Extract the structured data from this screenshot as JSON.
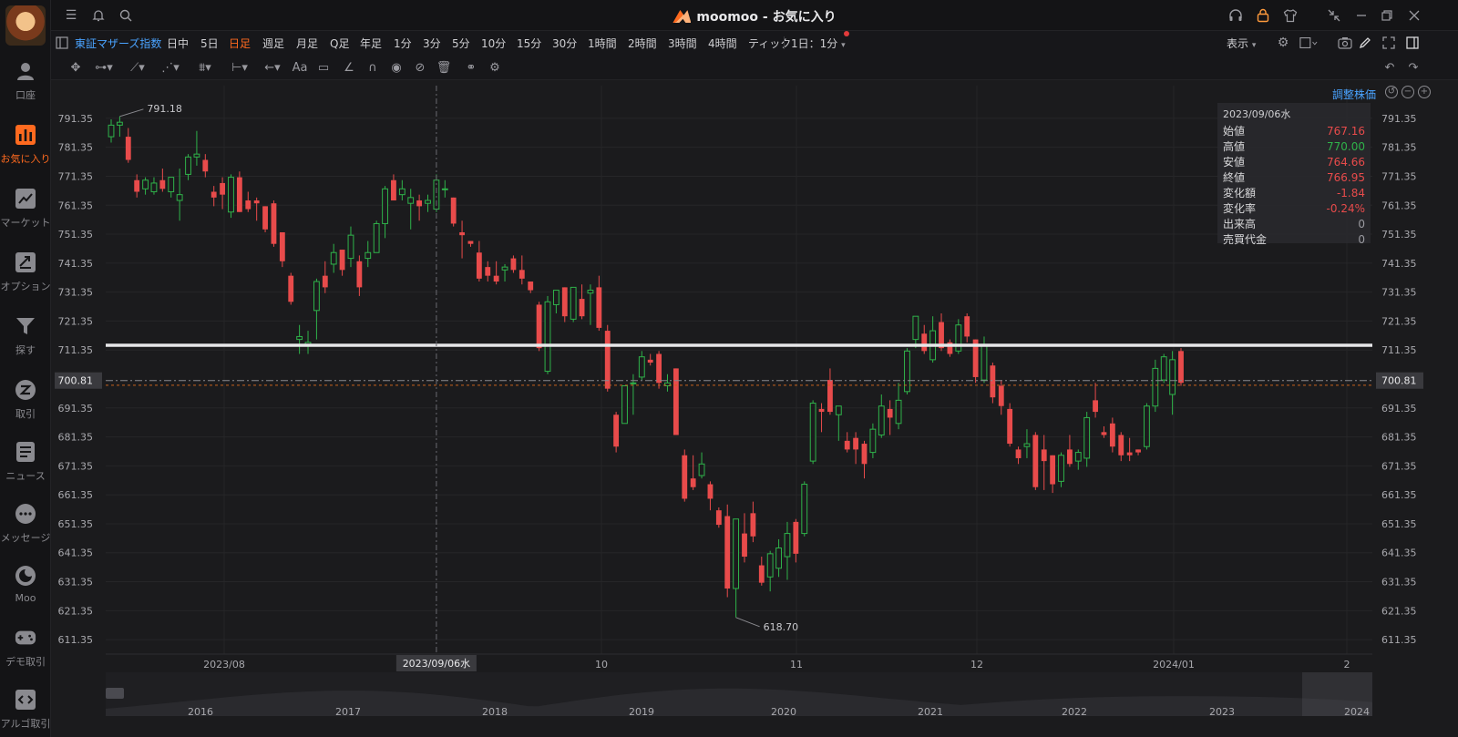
{
  "window": {
    "title": "moomoo - お気に入り"
  },
  "sidebar": {
    "items": [
      {
        "label": "口座",
        "icon": "person-icon"
      },
      {
        "label": "お気に入り",
        "icon": "bar-chart-icon"
      },
      {
        "label": "マーケット",
        "icon": "trend-icon"
      },
      {
        "label": "オプション",
        "icon": "option-icon"
      },
      {
        "label": "探す",
        "icon": "filter-icon"
      },
      {
        "label": "取引",
        "icon": "trade-icon"
      },
      {
        "label": "ニュース",
        "icon": "news-icon"
      },
      {
        "label": "メッセージ",
        "icon": "message-icon"
      },
      {
        "label": "Moo",
        "icon": "moo-icon"
      },
      {
        "label": "デモ取引",
        "icon": "gamepad-icon"
      },
      {
        "label": "アルゴ取引",
        "icon": "code-icon"
      }
    ],
    "active_index": 1
  },
  "toolbar": {
    "symbol": "東証マザーズ指数",
    "timeframes": [
      "日中",
      "5日",
      "日足",
      "週足",
      "月足",
      "Q足",
      "年足",
      "1分",
      "3分",
      "5分",
      "10分",
      "15分",
      "30分",
      "1時間",
      "2時間",
      "3時間",
      "4時間",
      "ティック"
    ],
    "active_timeframe": "日足",
    "interval_select": "1日：1分",
    "display_label": "表示"
  },
  "chart": {
    "adjust_label": "調整株価",
    "cursor_date_label": "2023/09/06水",
    "current_price_label": "700.81",
    "max_label": "791.18",
    "min_label": "618.70",
    "y_ticks": [
      "791.35",
      "781.35",
      "771.35",
      "761.35",
      "751.35",
      "741.35",
      "731.35",
      "721.35",
      "711.35",
      "700.81",
      "691.35",
      "681.35",
      "671.35",
      "661.35",
      "651.35",
      "641.35",
      "631.35",
      "621.35",
      "611.35"
    ],
    "x_ticks": [
      "2023/08",
      "10",
      "11",
      "12",
      "2024/01",
      "2"
    ],
    "navigator_years": [
      "2016",
      "2017",
      "2018",
      "2019",
      "2020",
      "2021",
      "2022",
      "2023",
      "2024"
    ]
  },
  "ohlc": {
    "date": "2023/09/06水",
    "rows": [
      {
        "label": "始値",
        "value": "767.16",
        "tone": "red"
      },
      {
        "label": "高値",
        "value": "770.00",
        "tone": "green"
      },
      {
        "label": "安値",
        "value": "764.66",
        "tone": "red"
      },
      {
        "label": "終値",
        "value": "766.95",
        "tone": "red"
      },
      {
        "label": "変化額",
        "value": "-1.84",
        "tone": "red"
      },
      {
        "label": "変化率",
        "value": "-0.24%",
        "tone": "red"
      },
      {
        "label": "出来高",
        "value": "0",
        "tone": "grey"
      },
      {
        "label": "売買代金",
        "value": "0",
        "tone": "grey"
      }
    ]
  },
  "colors": {
    "up": "#2fb34a",
    "down": "#e84b4b",
    "accent": "#ff6a1f",
    "link": "#4aa3ff"
  },
  "chart_data": {
    "type": "candlestick",
    "ylim": [
      606.35,
      796.35
    ],
    "candles": [
      {
        "o": 785,
        "h": 791,
        "l": 783,
        "c": 789
      },
      {
        "o": 789,
        "h": 792,
        "l": 785,
        "c": 790
      },
      {
        "o": 785,
        "h": 788,
        "l": 776,
        "c": 777
      },
      {
        "o": 770,
        "h": 772,
        "l": 764,
        "c": 766
      },
      {
        "o": 767,
        "h": 771,
        "l": 765,
        "c": 770
      },
      {
        "o": 766,
        "h": 771,
        "l": 765,
        "c": 769
      },
      {
        "o": 770,
        "h": 774,
        "l": 766,
        "c": 767
      },
      {
        "o": 766,
        "h": 771,
        "l": 764,
        "c": 771
      },
      {
        "o": 763,
        "h": 774,
        "l": 756,
        "c": 765
      },
      {
        "o": 772,
        "h": 779,
        "l": 770,
        "c": 778
      },
      {
        "o": 778,
        "h": 787,
        "l": 775,
        "c": 779
      },
      {
        "o": 777,
        "h": 779,
        "l": 771,
        "c": 773
      },
      {
        "o": 766,
        "h": 768,
        "l": 761,
        "c": 764
      },
      {
        "o": 769,
        "h": 771,
        "l": 760,
        "c": 765
      },
      {
        "o": 759,
        "h": 772,
        "l": 757,
        "c": 771
      },
      {
        "o": 771,
        "h": 773,
        "l": 759,
        "c": 759
      },
      {
        "o": 763,
        "h": 766,
        "l": 759,
        "c": 760
      },
      {
        "o": 763,
        "h": 764,
        "l": 756,
        "c": 762
      },
      {
        "o": 761,
        "h": 761,
        "l": 752,
        "c": 753
      },
      {
        "o": 762,
        "h": 763,
        "l": 747,
        "c": 748
      },
      {
        "o": 752,
        "h": 752,
        "l": 740,
        "c": 742
      },
      {
        "o": 737,
        "h": 738,
        "l": 727,
        "c": 728
      },
      {
        "o": 715,
        "h": 720,
        "l": 710,
        "c": 716
      },
      {
        "o": 713,
        "h": 718,
        "l": 710,
        "c": 714
      },
      {
        "o": 725,
        "h": 736,
        "l": 715,
        "c": 735
      },
      {
        "o": 737,
        "h": 742,
        "l": 731,
        "c": 733
      },
      {
        "o": 741,
        "h": 748,
        "l": 738,
        "c": 745
      },
      {
        "o": 746,
        "h": 746,
        "l": 737,
        "c": 739
      },
      {
        "o": 743,
        "h": 754,
        "l": 740,
        "c": 751
      },
      {
        "o": 742,
        "h": 744,
        "l": 730,
        "c": 733
      },
      {
        "o": 743,
        "h": 749,
        "l": 740,
        "c": 745
      },
      {
        "o": 745,
        "h": 756,
        "l": 745,
        "c": 755
      },
      {
        "o": 755,
        "h": 768,
        "l": 750,
        "c": 767
      },
      {
        "o": 770,
        "h": 772,
        "l": 763,
        "c": 763
      },
      {
        "o": 765,
        "h": 770,
        "l": 763,
        "c": 767
      },
      {
        "o": 762,
        "h": 767,
        "l": 753,
        "c": 764
      },
      {
        "o": 763,
        "h": 765,
        "l": 756,
        "c": 761
      },
      {
        "o": 762,
        "h": 765,
        "l": 759,
        "c": 763
      },
      {
        "o": 760,
        "h": 772,
        "l": 759,
        "c": 770
      },
      {
        "o": 767,
        "h": 770,
        "l": 764,
        "c": 767
      },
      {
        "o": 764,
        "h": 764,
        "l": 754,
        "c": 755
      },
      {
        "o": 752,
        "h": 756,
        "l": 743,
        "c": 751
      },
      {
        "o": 749,
        "h": 749,
        "l": 747,
        "c": 748
      },
      {
        "o": 745,
        "h": 749,
        "l": 735,
        "c": 736
      },
      {
        "o": 740,
        "h": 742,
        "l": 735,
        "c": 737
      },
      {
        "o": 737,
        "h": 742,
        "l": 734,
        "c": 735
      },
      {
        "o": 739,
        "h": 741,
        "l": 735,
        "c": 740
      },
      {
        "o": 743,
        "h": 744,
        "l": 738,
        "c": 739
      },
      {
        "o": 739,
        "h": 744,
        "l": 734,
        "c": 736
      },
      {
        "o": 735,
        "h": 735,
        "l": 731,
        "c": 732
      },
      {
        "o": 727,
        "h": 728,
        "l": 711,
        "c": 712
      },
      {
        "o": 704,
        "h": 730,
        "l": 703,
        "c": 728
      },
      {
        "o": 727,
        "h": 732,
        "l": 724,
        "c": 732
      },
      {
        "o": 733,
        "h": 733,
        "l": 721,
        "c": 723
      },
      {
        "o": 722,
        "h": 733,
        "l": 721,
        "c": 733
      },
      {
        "o": 729,
        "h": 734,
        "l": 722,
        "c": 723
      },
      {
        "o": 731,
        "h": 734,
        "l": 720,
        "c": 732
      },
      {
        "o": 733,
        "h": 737,
        "l": 718,
        "c": 719
      },
      {
        "o": 718,
        "h": 720,
        "l": 697,
        "c": 698
      },
      {
        "o": 689,
        "h": 690,
        "l": 676,
        "c": 678
      },
      {
        "o": 686,
        "h": 699,
        "l": 686,
        "c": 699
      },
      {
        "o": 700,
        "h": 703,
        "l": 689,
        "c": 700
      },
      {
        "o": 702,
        "h": 711,
        "l": 701,
        "c": 709
      },
      {
        "o": 708,
        "h": 710,
        "l": 706,
        "c": 707
      },
      {
        "o": 710,
        "h": 711,
        "l": 698,
        "c": 700
      },
      {
        "o": 699,
        "h": 703,
        "l": 697,
        "c": 700
      },
      {
        "o": 705,
        "h": 705,
        "l": 682,
        "c": 682
      },
      {
        "o": 675,
        "h": 677,
        "l": 659,
        "c": 660
      },
      {
        "o": 667,
        "h": 675,
        "l": 663,
        "c": 664
      },
      {
        "o": 668,
        "h": 676,
        "l": 667,
        "c": 672
      },
      {
        "o": 665,
        "h": 666,
        "l": 656,
        "c": 660
      },
      {
        "o": 656,
        "h": 657,
        "l": 650,
        "c": 651
      },
      {
        "o": 654,
        "h": 658,
        "l": 626,
        "c": 629
      },
      {
        "o": 629,
        "h": 650,
        "l": 619,
        "c": 653
      },
      {
        "o": 648,
        "h": 655,
        "l": 638,
        "c": 640
      },
      {
        "o": 655,
        "h": 659,
        "l": 645,
        "c": 647
      },
      {
        "o": 637,
        "h": 640,
        "l": 630,
        "c": 631
      },
      {
        "o": 633,
        "h": 642,
        "l": 628,
        "c": 641
      },
      {
        "o": 636,
        "h": 646,
        "l": 633,
        "c": 643
      },
      {
        "o": 640,
        "h": 652,
        "l": 632,
        "c": 648
      },
      {
        "o": 652,
        "h": 653,
        "l": 638,
        "c": 641
      },
      {
        "o": 648,
        "h": 666,
        "l": 647,
        "c": 665
      },
      {
        "o": 673,
        "h": 694,
        "l": 672,
        "c": 693
      },
      {
        "o": 691,
        "h": 693,
        "l": 683,
        "c": 690
      },
      {
        "o": 701,
        "h": 705,
        "l": 689,
        "c": 690
      },
      {
        "o": 689,
        "h": 692,
        "l": 680,
        "c": 692
      },
      {
        "o": 680,
        "h": 683,
        "l": 676,
        "c": 677
      },
      {
        "o": 681,
        "h": 683,
        "l": 672,
        "c": 677
      },
      {
        "o": 679,
        "h": 680,
        "l": 667,
        "c": 672
      },
      {
        "o": 676,
        "h": 686,
        "l": 674,
        "c": 684
      },
      {
        "o": 682,
        "h": 696,
        "l": 681,
        "c": 692
      },
      {
        "o": 691,
        "h": 694,
        "l": 682,
        "c": 688
      },
      {
        "o": 686,
        "h": 700,
        "l": 684,
        "c": 694
      },
      {
        "o": 697,
        "h": 712,
        "l": 696,
        "c": 711
      },
      {
        "o": 715,
        "h": 723,
        "l": 712,
        "c": 723
      },
      {
        "o": 717,
        "h": 720,
        "l": 710,
        "c": 711
      },
      {
        "o": 708,
        "h": 723,
        "l": 707,
        "c": 718
      },
      {
        "o": 721,
        "h": 724,
        "l": 711,
        "c": 712
      },
      {
        "o": 714,
        "h": 715,
        "l": 709,
        "c": 710
      },
      {
        "o": 711,
        "h": 722,
        "l": 710,
        "c": 720
      },
      {
        "o": 723,
        "h": 724,
        "l": 714,
        "c": 716
      },
      {
        "o": 715,
        "h": 715,
        "l": 700,
        "c": 702
      },
      {
        "o": 701,
        "h": 716,
        "l": 700,
        "c": 713
      },
      {
        "o": 706,
        "h": 707,
        "l": 693,
        "c": 695
      },
      {
        "o": 699,
        "h": 701,
        "l": 689,
        "c": 692
      },
      {
        "o": 691,
        "h": 693,
        "l": 678,
        "c": 679
      },
      {
        "o": 677,
        "h": 678,
        "l": 672,
        "c": 674
      },
      {
        "o": 678,
        "h": 684,
        "l": 674,
        "c": 679
      },
      {
        "o": 682,
        "h": 683,
        "l": 663,
        "c": 664
      },
      {
        "o": 677,
        "h": 682,
        "l": 663,
        "c": 673
      },
      {
        "o": 675,
        "h": 675,
        "l": 662,
        "c": 665
      },
      {
        "o": 666,
        "h": 676,
        "l": 664,
        "c": 675
      },
      {
        "o": 677,
        "h": 682,
        "l": 671,
        "c": 672
      },
      {
        "o": 673,
        "h": 677,
        "l": 670,
        "c": 676
      },
      {
        "o": 674,
        "h": 690,
        "l": 671,
        "c": 688
      },
      {
        "o": 694,
        "h": 700,
        "l": 688,
        "c": 690
      },
      {
        "o": 683,
        "h": 685,
        "l": 681,
        "c": 682
      },
      {
        "o": 686,
        "h": 688,
        "l": 676,
        "c": 678
      },
      {
        "o": 682,
        "h": 683,
        "l": 673,
        "c": 675
      },
      {
        "o": 676,
        "h": 681,
        "l": 673,
        "c": 675
      },
      {
        "o": 677,
        "h": 677,
        "l": 675,
        "c": 676
      },
      {
        "o": 678,
        "h": 693,
        "l": 677,
        "c": 692
      },
      {
        "o": 692,
        "h": 708,
        "l": 690,
        "c": 705
      },
      {
        "o": 701,
        "h": 710,
        "l": 700,
        "c": 709
      },
      {
        "o": 696,
        "h": 711,
        "l": 689,
        "c": 708
      },
      {
        "o": 711,
        "h": 712,
        "l": 699,
        "c": 700
      }
    ],
    "resistance_level": 713.0,
    "current_price": 700.81,
    "reference_line": 699.2,
    "cursor_index": 38
  }
}
